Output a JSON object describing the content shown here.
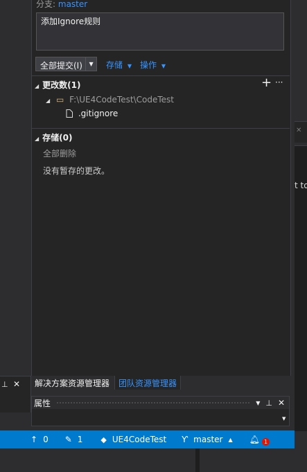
{
  "branch": {
    "label": "分支:",
    "name": "master"
  },
  "commit_message": "添加Ignore规则",
  "toolbar": {
    "commit_all_label": "全部提交(I)",
    "stash_label": "存储",
    "actions_label": "操作"
  },
  "changes": {
    "title": "更改数(1)",
    "folder": "F:\\UE4CodeTest\\CodeTest",
    "files": [
      ".gitignore"
    ],
    "add_icon": "plus-icon",
    "more_icon": "ellipsis-icon"
  },
  "stashes": {
    "title": "存储(0)",
    "delete_all": "全部删除",
    "empty_text": "没有暂存的更改。"
  },
  "right_clipped_text": "t to",
  "tabs": [
    {
      "label": "解决方案资源管理器"
    },
    {
      "label": "团队资源管理器"
    }
  ],
  "properties": {
    "title": "属性"
  },
  "status_bar": {
    "push_count": "0",
    "edit_count": "1",
    "repo": "UE4CodeTest",
    "branch": "master",
    "notification_count": "1"
  },
  "colors": {
    "accent": "#007acc",
    "link": "#3794ff",
    "badge": "#e51400",
    "panel": "#252526"
  }
}
